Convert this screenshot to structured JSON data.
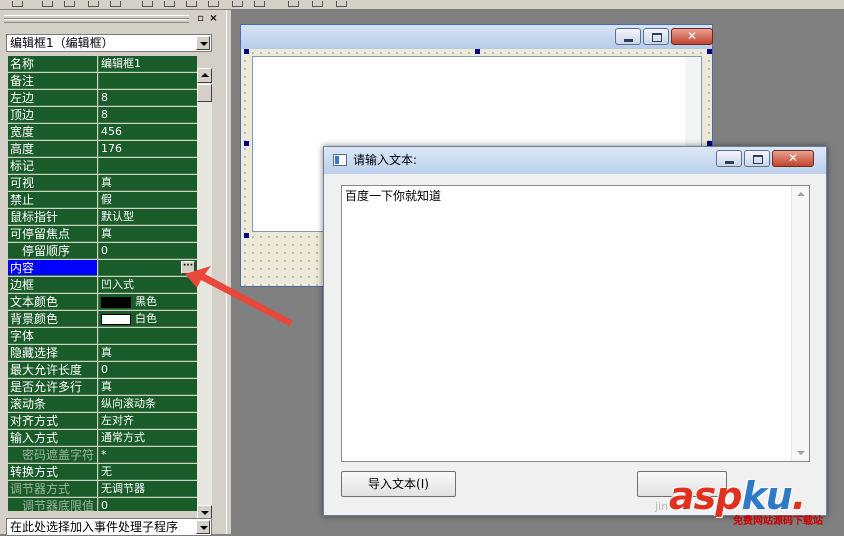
{
  "panel": {
    "object_selector": "编辑框1（编辑框）",
    "event_selector": "在此处选择加入事件处理子程序",
    "properties": [
      {
        "name": "名称",
        "value": "编辑框1"
      },
      {
        "name": "备注",
        "value": ""
      },
      {
        "name": "左边",
        "value": "8"
      },
      {
        "name": "顶边",
        "value": "8"
      },
      {
        "name": "宽度",
        "value": "456"
      },
      {
        "name": "高度",
        "value": "176"
      },
      {
        "name": "标记",
        "value": ""
      },
      {
        "name": "可视",
        "value": "真"
      },
      {
        "name": "禁止",
        "value": "假"
      },
      {
        "name": "鼠标指针",
        "value": "默认型"
      },
      {
        "name": "可停留焦点",
        "value": "真"
      },
      {
        "name": "停留顺序",
        "value": "0"
      },
      {
        "name": "内容",
        "value": ""
      },
      {
        "name": "边框",
        "value": "凹入式"
      },
      {
        "name": "文本颜色",
        "value": "黑色"
      },
      {
        "name": "背景颜色",
        "value": "白色"
      },
      {
        "name": "字体",
        "value": ""
      },
      {
        "name": "隐藏选择",
        "value": "真"
      },
      {
        "name": "最大允许长度",
        "value": "0"
      },
      {
        "name": "是否允许多行",
        "value": "真"
      },
      {
        "name": "滚动条",
        "value": "纵向滚动条"
      },
      {
        "name": "对齐方式",
        "value": "左对齐"
      },
      {
        "name": "输入方式",
        "value": "通常方式"
      },
      {
        "name": "密码遮盖字符",
        "value": "*"
      },
      {
        "name": "转换方式",
        "value": "无"
      },
      {
        "name": "调节器方式",
        "value": "无调节器"
      },
      {
        "name": "调节器底限值",
        "value": "0"
      }
    ],
    "ellipsis": "···",
    "text_color_swatch": "#000000",
    "bg_color_swatch": "#ffffff",
    "selected_color": "#0000ff",
    "row_color": "#1a5b2a"
  },
  "dialog": {
    "title": "请输入文本:",
    "text": "百度一下你就知道",
    "import_button": "导入文本(I)",
    "close_glyph": "✕"
  },
  "design_form": {
    "close_glyph": "✕"
  },
  "watermark": {
    "main_a": "asp",
    "main_b": "ku",
    "dot": ".",
    "sub": "免费网站源码下载站",
    "faint": "jin"
  }
}
